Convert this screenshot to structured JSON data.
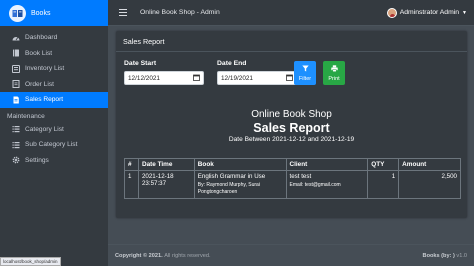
{
  "app": {
    "brand": "Books"
  },
  "sidebar": {
    "items": [
      {
        "label": "Dashboard",
        "icon": "dashboard-icon"
      },
      {
        "label": "Book List",
        "icon": "book-icon"
      },
      {
        "label": "Inventory List",
        "icon": "inventory-icon"
      },
      {
        "label": "Order List",
        "icon": "order-icon"
      },
      {
        "label": "Sales Report",
        "icon": "report-icon",
        "active": true
      }
    ],
    "maintenance_label": "Maintenance",
    "maintenance_items": [
      {
        "label": "Category List",
        "icon": "list-icon"
      },
      {
        "label": "Sub Category List",
        "icon": "list-icon"
      },
      {
        "label": "Settings",
        "icon": "gear-icon"
      }
    ],
    "status_url": "localhost/book_shop/admin"
  },
  "topbar": {
    "title": "Online Book Shop - Admin",
    "user": "Adminstrator Admin"
  },
  "card": {
    "title": "Sales Report"
  },
  "filters": {
    "start_label": "Date Start",
    "start_value": "12/12/2021",
    "end_label": "Date End",
    "end_value": "12/19/2021",
    "filter_label": "Filter",
    "print_label": "Print"
  },
  "report": {
    "shop": "Online Book Shop",
    "title": "Sales Report",
    "range": "Date Between 2021-12-12 and 2021-12-19",
    "columns": [
      "#",
      "Date Time",
      "Book",
      "Client",
      "QTY",
      "Amount"
    ],
    "rows": [
      {
        "no": "1",
        "datetime": "2021-12-18 23:57:37",
        "book": "English Grammar in Use",
        "book_meta": "By: Raymond Murphy, Surai Pongtongcharoen",
        "client": "test test",
        "client_meta": "Email: test@gmail.com",
        "qty": "1",
        "amount": "2,500"
      }
    ]
  },
  "footer": {
    "copyright": "Copyright © 2021.",
    "rights": "All rights reserved.",
    "brand": "Books (by: )",
    "version": "v1.0"
  },
  "colors": {
    "primary": "#007bff",
    "filter": "#1e90ff",
    "print": "#28a745",
    "sidebar": "#343a40",
    "body": "#454d55"
  }
}
